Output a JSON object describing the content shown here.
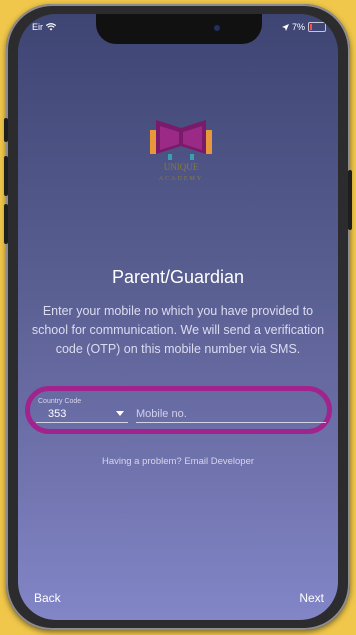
{
  "status_bar": {
    "carrier": "Eir",
    "battery": "7%"
  },
  "logo": {
    "text_lines": [
      "UNIQUE",
      "ACADEMY"
    ]
  },
  "title": "Parent/Guardian",
  "description": "Enter your mobile no which you have provided to school for communication. We will send a verification code (OTP) on this mobile number via SMS.",
  "form": {
    "country_code_label": "Country Code",
    "country_code_value": "353",
    "mobile_placeholder": "Mobile no."
  },
  "help_text": "Having a problem? Email Developer",
  "footer": {
    "back_label": "Back",
    "next_label": "Next"
  },
  "colors": {
    "background": "#f0c74a",
    "highlight": "#a1248e",
    "screen_top": "#3e4573",
    "screen_bottom": "#8286c7"
  }
}
